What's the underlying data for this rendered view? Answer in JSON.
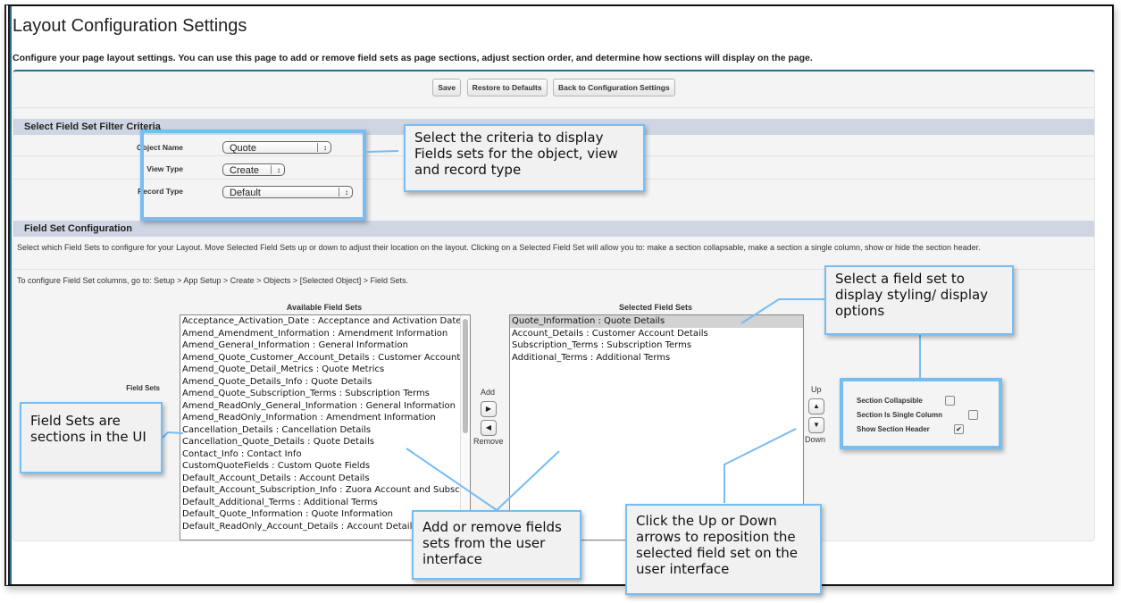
{
  "page": {
    "title": "Layout Configuration Settings",
    "description": "Configure your page layout settings. You can use this page to add or remove field sets as page sections, adjust section order, and determine how sections will display on the page."
  },
  "toolbar": {
    "save_label": "Save",
    "restore_label": "Restore to Defaults",
    "back_label": "Back to Configuration Settings"
  },
  "filter": {
    "section_title": "Select Field Set Filter Criteria",
    "object_name_label": "Object Name",
    "object_name_value": "Quote",
    "view_type_label": "View Type",
    "view_type_value": "Create",
    "record_type_label": "Record Type",
    "record_type_value": "Default"
  },
  "config": {
    "section_title": "Field Set Configuration",
    "instructions": "Select which Field Sets to configure for your Layout. Move Selected Field Sets up or down to adjust their location on the layout. Clicking on a Selected Field Set will allow you to: make a section collapsable, make a section a single column, show or hide the section header.",
    "columns_note": "To configure Field Set columns, go to: Setup > App Setup > Create > Objects > [Selected Object] > Field Sets.",
    "field_sets_label": "Field Sets",
    "available_header": "Available Field Sets",
    "selected_header": "Selected Field Sets",
    "available": [
      "Acceptance_Activation_Date : Acceptance and Activation Date",
      "Amend_Amendment_Information : Amendment Information",
      "Amend_General_Information : General Information",
      "Amend_Quote_Customer_Account_Details : Customer Account Details",
      "Amend_Quote_Detail_Metrics : Quote Metrics",
      "Amend_Quote_Details_Info : Quote Details",
      "Amend_Quote_Subscription_Terms : Subscription Terms",
      "Amend_ReadOnly_General_Information : General Information",
      "Amend_ReadOnly_Information : Amendment Information",
      "Cancellation_Details : Cancellation Details",
      "Cancellation_Quote_Details : Quote Details",
      "Contact_Info : Contact Info",
      "CustomQuoteFields : Custom Quote Fields",
      "Default_Account_Details : Account Details",
      "Default_Account_Subscription_Info : Zuora Account and Subscription Info",
      "Default_Additional_Terms : Additional Terms",
      "Default_Quote_Information : Quote Information",
      "Default_ReadOnly_Account_Details : Account Details"
    ],
    "selected": [
      "Quote_Information : Quote Details",
      "Account_Details : Customer Account Details",
      "Subscription_Terms : Subscription Terms",
      "Additional_Terms : Additional Terms"
    ],
    "selected_index": 0,
    "add_label": "Add",
    "remove_label": "Remove",
    "up_label": "Up",
    "down_label": "Down",
    "options": {
      "collapsible_label": "Section Collapsible",
      "collapsible_checked": false,
      "single_column_label": "Section Is Single Column",
      "single_column_checked": false,
      "show_header_label": "Show Section Header",
      "show_header_checked": true
    }
  },
  "callouts": {
    "criteria": "Select the criteria to display Fields sets for the object, view and record type",
    "styling": "Select a field set to display styling/ display options",
    "field_sets": "Field Sets are sections in the UI",
    "add_remove": "Add or remove fields sets from the user interface",
    "up_down": "Click the Up or Down arrows to reposition the selected field set on the user interface"
  },
  "colors": {
    "accent_blue": "#76bdf2",
    "section_header": "#cfd5e3",
    "top_border": "#2f6a8e"
  }
}
